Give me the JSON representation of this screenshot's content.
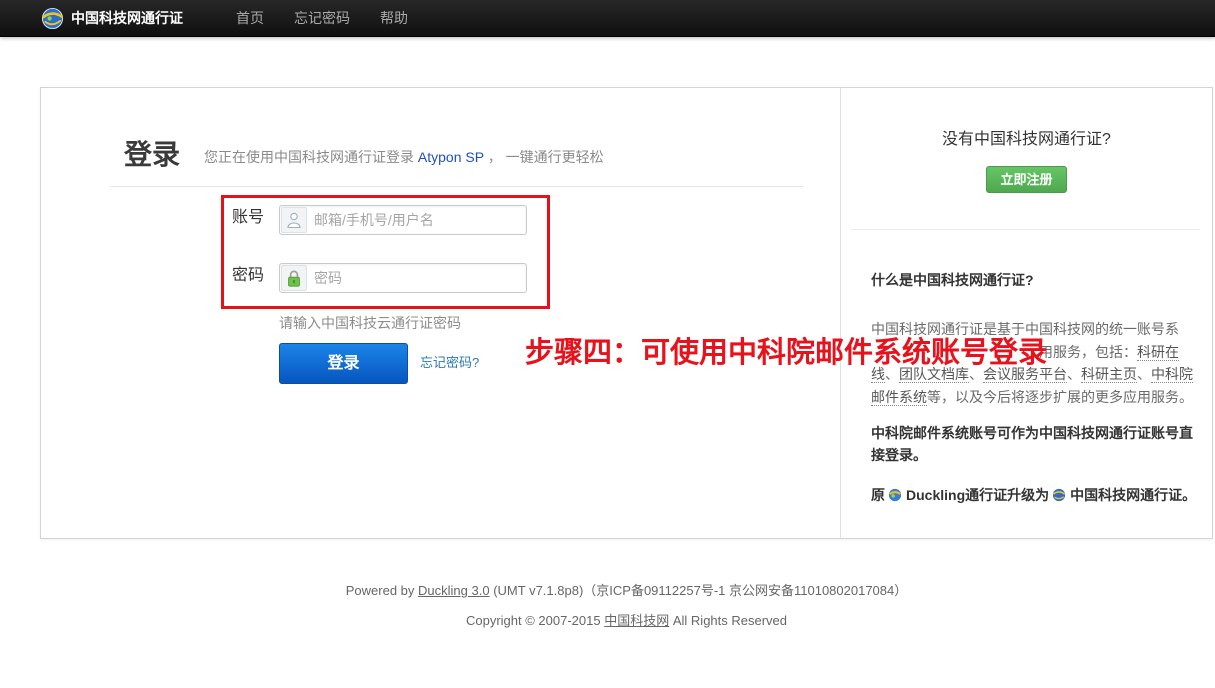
{
  "navbar": {
    "brand": "中国科技网通行证",
    "items": [
      {
        "label": "首页"
      },
      {
        "label": "忘记密码"
      },
      {
        "label": "帮助"
      }
    ]
  },
  "login": {
    "title": "登录",
    "subtitle": {
      "prefix": "您正在使用中国科技网通行证登录",
      "service": "Atypon SP",
      "suffix": "， 一键通行更轻松"
    },
    "account": {
      "label": "账号",
      "placeholder": "邮箱/手机号/用户名",
      "value": ""
    },
    "password": {
      "label": "密码",
      "placeholder": "密码",
      "value": ""
    },
    "hint": "请输入中国科技云通行证密码",
    "submit": "登录",
    "forgot": "忘记密码?"
  },
  "annotation": {
    "text": "步骤四：可使用中科院邮件系统账号登录"
  },
  "sidebar": {
    "no_account": "没有中国科技网通行证?",
    "register": "立即注册",
    "about": {
      "title": "什么是中国科技网通行证?",
      "line1": "中国科技网通行证是基于中国科技网的统一账号系",
      "line2": "用服务，包括：",
      "separator": "、",
      "links": {
        "research_online_part1": "科研在",
        "research_online_part2": "线",
        "team_docs": "团队文档库",
        "meeting_platform": "会议服务平台",
        "research_homepage": "科研主页",
        "cas_mail_part1": "中科院",
        "cas_mail_part2": "邮件系统"
      },
      "line4_tail": "等，以及今后将逐步扩展的更多应用服务。"
    },
    "cas_mail_note": {
      "line1": "中科院邮件系统账号可作为中国科技网通行证账号直",
      "line2": "接登录。"
    },
    "upgrade_note": {
      "prefix": "原",
      "old_name": "Duckling通行证升级为",
      "new_name": "中国科技网通行证。"
    }
  },
  "footer": {
    "powered_prefix": "Powered by",
    "duckling_link": "Duckling 3.0",
    "powered_suffix": "(UMT v7.1.8p8)（京ICP备09112257号-1 京公网安备11010802017084）",
    "copyright_prefix": "Copyright © 2007-2015",
    "org_link": "中国科技网",
    "copyright_suffix": "All Rights Reserved"
  },
  "colors": {
    "navbar_bg": "#161616",
    "primary_button": "#0d6bd3",
    "register_button": "#56b156",
    "annotation_red": "#e8121c",
    "subtitle_link_blue": "#1f4fc7",
    "forgot_link_blue": "#2a78b6"
  },
  "icons": {
    "brand": "globe-logo-icon",
    "account": "user-icon",
    "password": "lock-icon",
    "duckling": "duckling-logo-icon",
    "cstnet": "globe-logo-icon"
  }
}
